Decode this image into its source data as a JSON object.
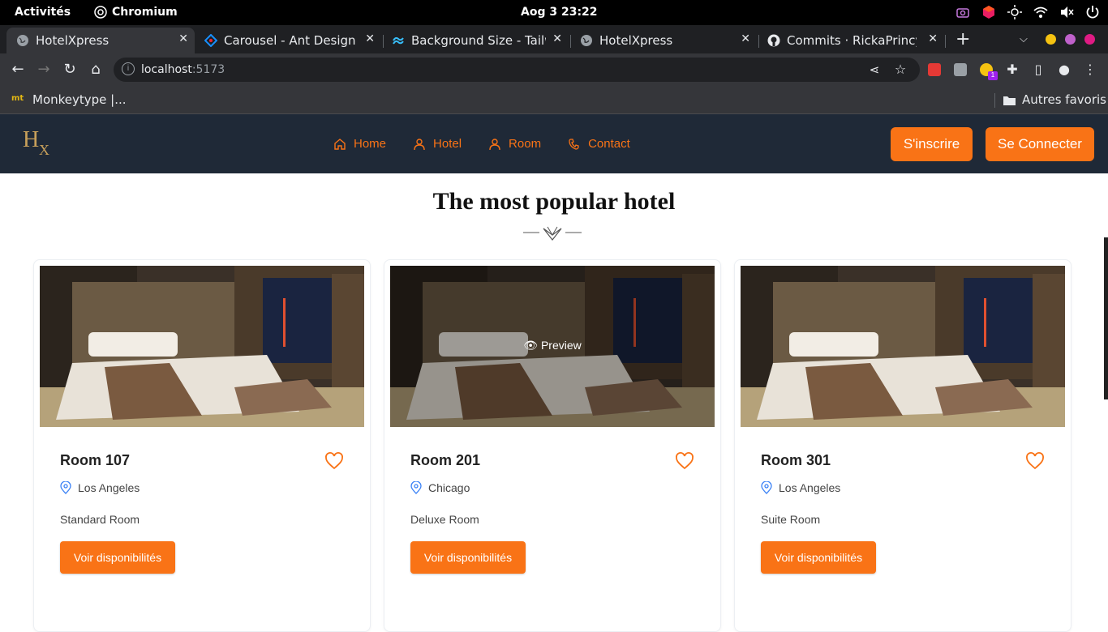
{
  "os_bar": {
    "activities": "Activités",
    "app_name": "Chromium",
    "clock": "Aog 3  23:22"
  },
  "browser": {
    "tabs": [
      {
        "title": "HotelXpress",
        "active": true,
        "icon": "globe-icon"
      },
      {
        "title": "Carousel - Ant Design",
        "active": false,
        "icon": "ant-design-icon"
      },
      {
        "title": "Background Size - Tailwi",
        "active": false,
        "icon": "tailwind-icon"
      },
      {
        "title": "HotelXpress",
        "active": false,
        "icon": "globe-icon"
      },
      {
        "title": "Commits · RickaPrincy/h",
        "active": false,
        "icon": "github-icon"
      }
    ],
    "url_host": "localhost",
    "url_port": ":5173",
    "bookmarks": [
      {
        "label": "Monkeytype |..."
      }
    ],
    "other_bookmarks": "Autres favoris",
    "extension_badge": "1"
  },
  "site": {
    "logo_letters": "H",
    "logo_x": "X",
    "nav": [
      {
        "label": "Home",
        "icon": "home-icon"
      },
      {
        "label": "Hotel",
        "icon": "user-icon"
      },
      {
        "label": "Room",
        "icon": "user-icon"
      },
      {
        "label": "Contact",
        "icon": "phone-icon"
      }
    ],
    "signup_label": "S'inscrire",
    "login_label": "Se Connecter",
    "colors": {
      "accent": "#f97316",
      "header_bg": "#1f2937",
      "location_icon": "#3b82f6"
    }
  },
  "section": {
    "title": "The most popular hotel"
  },
  "rooms": [
    {
      "name": "Room 107",
      "city": "Los Angeles",
      "type": "Standard Room",
      "cta": "Voir disponibilités"
    },
    {
      "name": "Room 201",
      "city": "Chicago",
      "type": "Deluxe Room",
      "cta": "Voir disponibilités",
      "preview": "Preview"
    },
    {
      "name": "Room 301",
      "city": "Los Angeles",
      "type": "Suite Room",
      "cta": "Voir disponibilités"
    }
  ]
}
